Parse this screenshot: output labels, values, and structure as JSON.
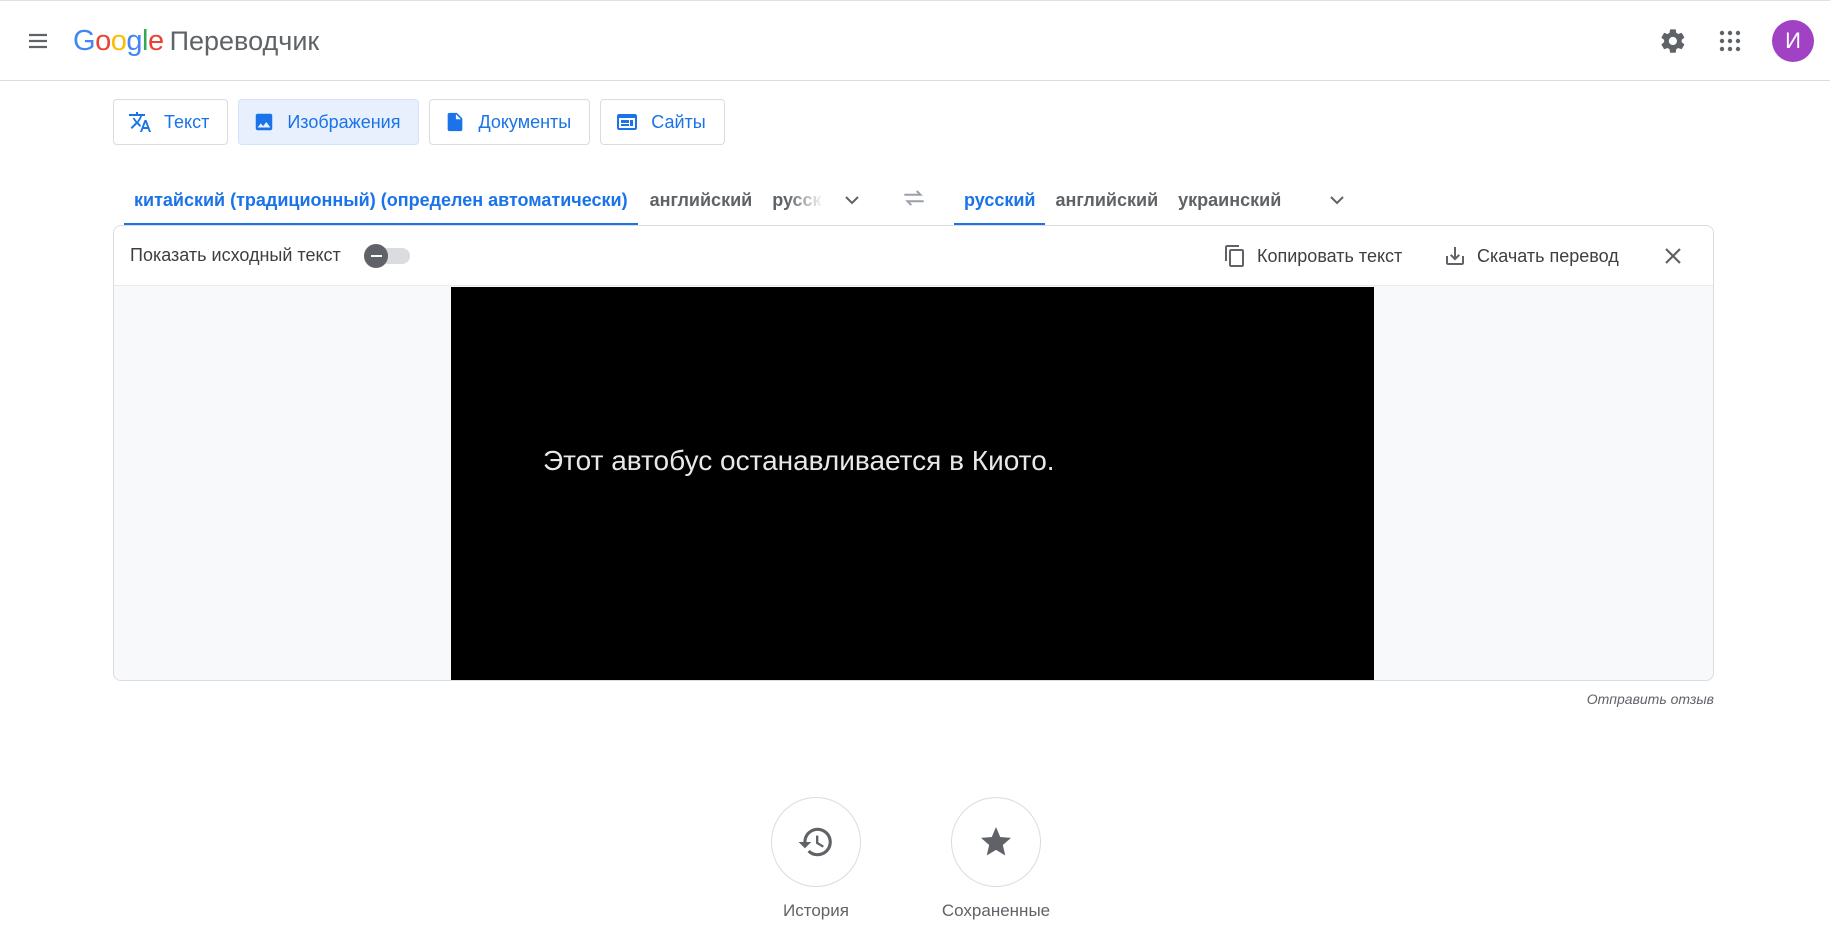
{
  "header": {
    "logo": [
      "G",
      "o",
      "o",
      "g",
      "l",
      "e"
    ],
    "product": "Переводчик",
    "avatar_letter": "И",
    "icons": [
      "menu-icon",
      "gear-icon",
      "apps-grid-icon"
    ]
  },
  "modes": [
    {
      "label": "Текст",
      "icon": "translate-icon",
      "active": false
    },
    {
      "label": "Изображения",
      "icon": "image-icon",
      "active": true
    },
    {
      "label": "Документы",
      "icon": "document-icon",
      "active": false
    },
    {
      "label": "Сайты",
      "icon": "website-icon",
      "active": false
    }
  ],
  "source_langs": [
    {
      "label": "китайский (традиционный) (определен автоматически)",
      "active": true
    },
    {
      "label": "английский",
      "active": false
    },
    {
      "label": "русский",
      "active": false
    }
  ],
  "target_langs": [
    {
      "label": "русский",
      "active": true
    },
    {
      "label": "английский",
      "active": false
    },
    {
      "label": "украинский",
      "active": false
    }
  ],
  "toolbar": {
    "show_source": "Показать исходный текст",
    "show_source_on": false,
    "copy": "Копировать текст",
    "download": "Скачать перевод"
  },
  "image": {
    "text": "Этот автобус останавливается в Киото.",
    "background": "#000000"
  },
  "feedback": "Отправить отзыв",
  "bottom": {
    "history": "История",
    "saved": "Сохраненные"
  },
  "colors": {
    "accent": "#1a73e8",
    "active_bg": "#e8f0fe",
    "avatar": "#a142c4"
  }
}
